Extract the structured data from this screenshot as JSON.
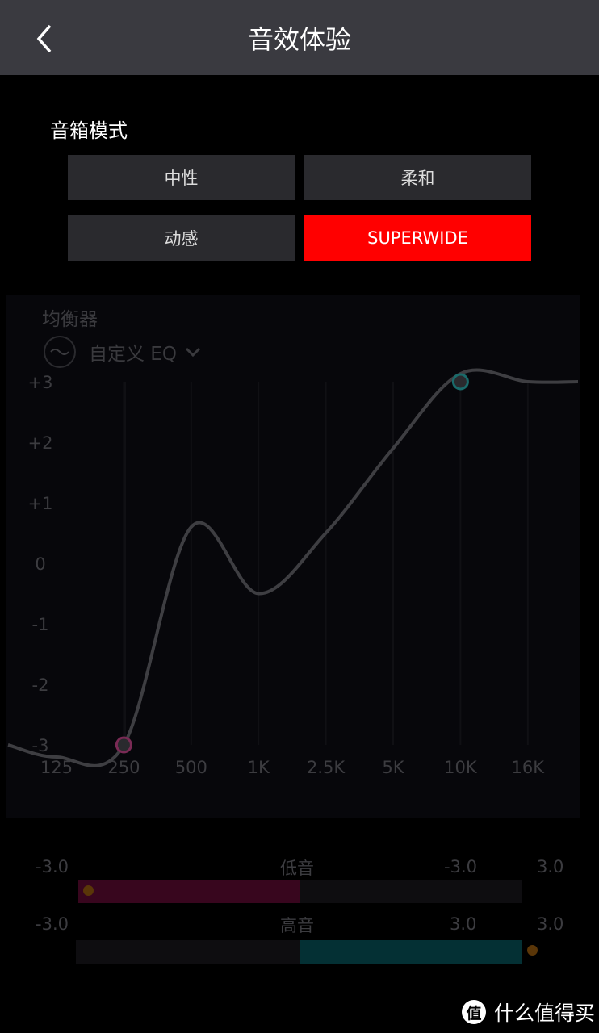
{
  "header": {
    "title": "音效体验",
    "back_icon": "chevron-left-icon"
  },
  "speaker_mode": {
    "label": "音箱模式",
    "modes": [
      {
        "label": "中性",
        "active": false
      },
      {
        "label": "柔和",
        "active": false
      },
      {
        "label": "动感",
        "active": false
      },
      {
        "label": "SUPERWIDE",
        "active": true
      }
    ],
    "active_color": "#ff0000"
  },
  "equalizer": {
    "title": "均衡器",
    "preset": "自定义 EQ"
  },
  "chart_data": {
    "type": "line",
    "categories": [
      "125",
      "250",
      "500",
      "1K",
      "2.5K",
      "5K",
      "10K",
      "16K"
    ],
    "values": [
      -3,
      -3,
      0.6,
      -0.5,
      0.5,
      1.9,
      3,
      3
    ],
    "y_ticks": [
      "+3",
      "+2",
      "+1",
      "0",
      "-1",
      "-2",
      "-3"
    ],
    "ylim": [
      -3,
      3
    ],
    "grid": true,
    "handles": [
      {
        "x": "250",
        "y": -3,
        "color": "#7a2a55"
      },
      {
        "x": "10K",
        "y": 3,
        "color": "#1a6a6a"
      }
    ]
  },
  "bass": {
    "label": "低音",
    "min": "-3.0",
    "value": "-3.0",
    "max": "3.0",
    "level": -3.0,
    "color": "#38061e"
  },
  "treble": {
    "label": "高音",
    "min": "-3.0",
    "value": "3.0",
    "max": "3.0",
    "level": 3.0,
    "color": "#043034"
  },
  "watermark": {
    "icon": "值",
    "text": "什么值得买"
  }
}
